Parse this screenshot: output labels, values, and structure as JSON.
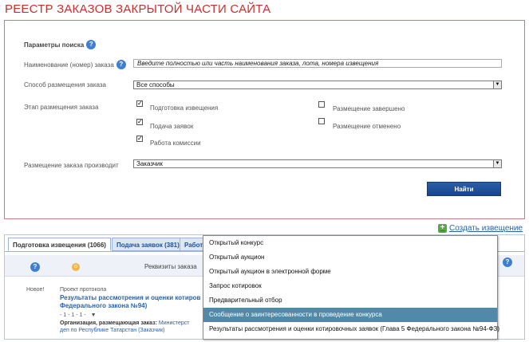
{
  "page_title": "РЕЕСТР ЗАКАЗОВ ЗАКРЫТОЙ ЧАСТИ САЙТА",
  "search": {
    "header": "Параметры поиска",
    "name_label": "Наименование (номер) заказа",
    "name_placeholder": "Введите полностью или часть наименования заказа, лота, номера извещения",
    "method_label": "Способ размещения заказа",
    "method_value": "Все способы",
    "stage_label": "Этап размещения заказа",
    "stages": [
      {
        "label": "Подготовка извещения",
        "checked": true
      },
      {
        "label": "Подача заявок",
        "checked": true
      },
      {
        "label": "Работа комиссии",
        "checked": true
      },
      {
        "label": "Размещение завершено",
        "checked": false
      },
      {
        "label": "Размещение отменено",
        "checked": false
      }
    ],
    "producer_label": "Размещение заказа производит",
    "producer_value": "Заказчик",
    "find_button": "Найти"
  },
  "create_link": "Создать извещение",
  "tabs": [
    {
      "label": "Подготовка извещения (1066)",
      "active": true
    },
    {
      "label": "Подача заявок (381)",
      "active": false
    },
    {
      "label": "Работ",
      "active": false
    }
  ],
  "table": {
    "requisites_header": "Реквизиты заказа",
    "row": {
      "status": "Новое!",
      "type": "Проект протокола",
      "title": "Результаты рассмотрения и оценки котиров Федерального закона №94)",
      "number": "- 1 - 1 - 1 -",
      "org_label": "Организация, размещающая заказ:",
      "org_value": "Министерст",
      "dept": "деп по Республике Татарстан (Заказчик)"
    }
  },
  "dropdown": {
    "items": [
      "Открытый конкурс",
      "Открытый аукцион",
      "Открытый аукцион в электронной форме",
      "Запрос котировок",
      "Предварительный отбор",
      "Сообщение о заинтересованности в проведение конкурса",
      "Результаты рассмотрения и оценки котировочных заявок (Глава 5 Федерального закона №94-ФЗ)"
    ],
    "highlighted_index": 5
  },
  "colors": {
    "title": "#c8312b",
    "link": "#2a62a8",
    "button": "#1f4f96",
    "highlight": "#4f8ba9"
  }
}
